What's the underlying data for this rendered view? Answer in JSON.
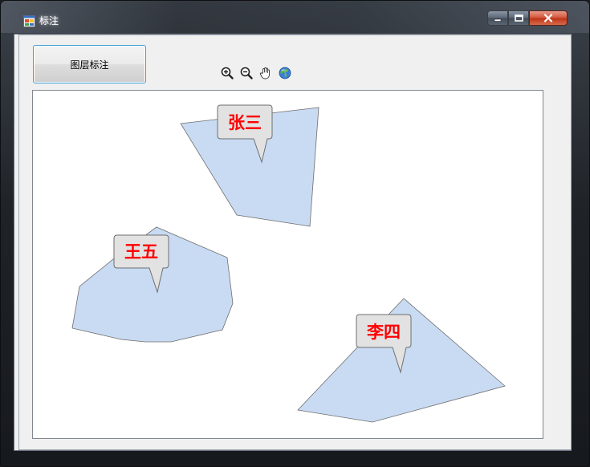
{
  "window": {
    "title": "标注",
    "icon": "app-window-icon",
    "caption_buttons": [
      "minimize-icon",
      "maximize-icon",
      "close-icon"
    ]
  },
  "toolbar": {
    "layer_label_button": "图层标注",
    "tools": [
      {
        "name": "zoom-in-icon"
      },
      {
        "name": "zoom-out-icon"
      },
      {
        "name": "pan-hand-icon"
      },
      {
        "name": "full-extent-globe-icon"
      }
    ]
  },
  "map": {
    "polygon_fill": "#c9dbf3",
    "label_color": "#ff0000",
    "labels": [
      {
        "id": "zhangsan",
        "text": "张三"
      },
      {
        "id": "wangwu",
        "text": "王五"
      },
      {
        "id": "lisi",
        "text": "李四"
      }
    ]
  }
}
